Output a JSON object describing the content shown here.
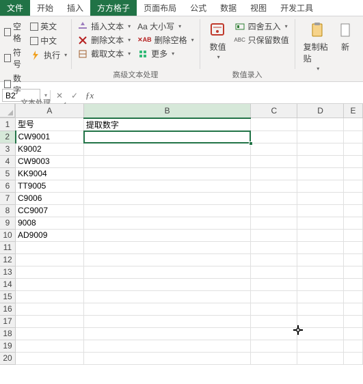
{
  "tabs": {
    "file": "文件",
    "home": "开始",
    "insert": "插入",
    "ffgz": "方方格子",
    "layout": "页面布局",
    "formula": "公式",
    "data": "数据",
    "view": "视图",
    "dev": "开发工具"
  },
  "ribbon": {
    "g1": {
      "title": "文本处理",
      "space": "空格",
      "english": "英文",
      "symbol": "符号",
      "chinese": "中文",
      "number": "数字",
      "execute": "执行"
    },
    "g2": {
      "title": "高级文本处理",
      "insert_text": "插入文本",
      "delete_text": "删除文本",
      "cut_text": "截取文本",
      "case": "Aa 大小写",
      "del_space": "删除空格",
      "more": "更多"
    },
    "g3": {
      "title": "数值录入",
      "num_value": "数值",
      "round": "四舍五入",
      "keep_only": "只保留数值",
      "copy_paste": "复制粘贴",
      "new": "新"
    }
  },
  "fbar": {
    "name": "B2",
    "formula": ""
  },
  "grid": {
    "cols": [
      "A",
      "B",
      "C",
      "D",
      "E"
    ],
    "rows": [
      "1",
      "2",
      "3",
      "4",
      "5",
      "6",
      "7",
      "8",
      "9",
      "10",
      "11",
      "12",
      "13",
      "14",
      "15",
      "16",
      "17",
      "18",
      "19",
      "20"
    ],
    "data": {
      "A1": "型号",
      "B1": "提取数字",
      "A2": "CW9001",
      "A3": "K9002",
      "A4": "CW9003",
      "A5": "KK9004",
      "A6": "TT9005",
      "A7": "C9006",
      "A8": "CC9007",
      "A9": "9008",
      "A10": "AD9009"
    }
  }
}
